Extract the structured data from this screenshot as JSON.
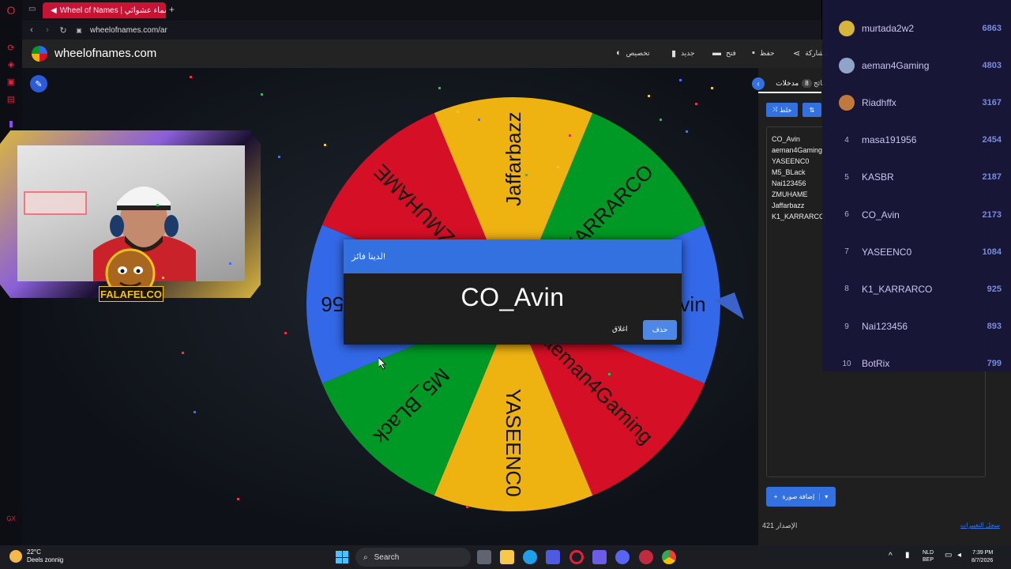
{
  "browser": {
    "tab_title": "Wheel of Names | عجلة أسماء عشوائي",
    "new_tab": "+",
    "url": "wheelofnames.com/ar"
  },
  "site": {
    "title": "wheelofnames.com",
    "menu": {
      "customize": "تخصيص",
      "new": "جديد",
      "open": "فتح",
      "save": "حفظ",
      "share": "مشاركة"
    }
  },
  "wheel": {
    "segments": [
      {
        "label": "CO_Avin",
        "color": "#3369e8"
      },
      {
        "label": "aeman4Gaming",
        "color": "#d50f25"
      },
      {
        "label": "YASEENC0",
        "color": "#eeb211"
      },
      {
        "label": "M5_BLack",
        "color": "#009925"
      },
      {
        "label": "Nai123456",
        "color": "#3369e8"
      },
      {
        "label": "ZMUHAME",
        "color": "#d50f25"
      },
      {
        "label": "Jaffarbazz",
        "color": "#eeb211"
      },
      {
        "label": "K1_KARRARCO",
        "color": "#009925"
      }
    ]
  },
  "dialog": {
    "title": "لدينا فائز!",
    "winner": "CO_Avin",
    "remove_label": "حذف",
    "close_label": "اغلاق"
  },
  "panel": {
    "entries_tab": "مدخلات",
    "entries_count": "8",
    "results_tab": "نتائج",
    "shuffle_label": "خلط",
    "entries": [
      "CO_Avin",
      "aeman4Gaming",
      "YASEENC0",
      "M5_BLack",
      "Nai123456",
      "ZMUHAME",
      "Jaffarbazz",
      "K1_KARRARCO"
    ],
    "add_image": "إضافة صورة",
    "version": "الإصدار 421",
    "changelog": "سجل التغييرات"
  },
  "leaderboard": [
    {
      "rank": "",
      "name": "murtada2w2",
      "score": "6863",
      "medal": "#d7b53a"
    },
    {
      "rank": "",
      "name": "aeman4Gaming",
      "score": "4803",
      "medal": "#8ea4c8"
    },
    {
      "rank": "",
      "name": "Riadhffx",
      "score": "3167",
      "medal": "#c0793d"
    },
    {
      "rank": "4",
      "name": "masa191956",
      "score": "2454"
    },
    {
      "rank": "5",
      "name": "KASBR",
      "score": "2187"
    },
    {
      "rank": "6",
      "name": "CO_Avin",
      "score": "2173"
    },
    {
      "rank": "7",
      "name": "YASEENC0",
      "score": "1084"
    },
    {
      "rank": "8",
      "name": "K1_KARRARCO",
      "score": "925"
    },
    {
      "rank": "9",
      "name": "Nai123456",
      "score": "893"
    },
    {
      "rank": "10",
      "name": "BotRix",
      "score": "799"
    }
  ],
  "webcam": {
    "badge_text": "FALAFELCO"
  },
  "taskbar": {
    "temperature": "22°C",
    "weather": "Deels zonnig",
    "search_placeholder": "Search",
    "lang": "NLD",
    "lang_sub": "BEP",
    "time": "7:39 PM",
    "date": "8/7/2026"
  }
}
